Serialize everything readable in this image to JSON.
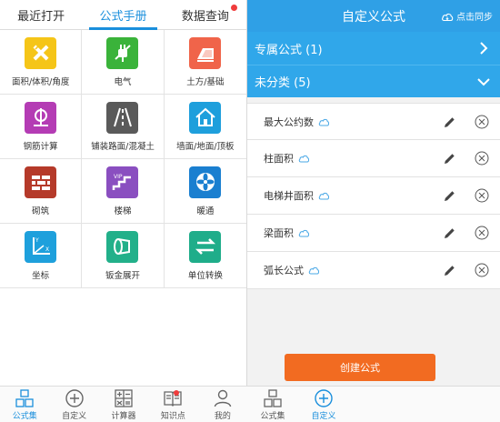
{
  "left": {
    "tabs": [
      {
        "label": "最近打开"
      },
      {
        "label": "公式手册"
      },
      {
        "label": "数据查询"
      }
    ],
    "grid": [
      {
        "label": "面积/体积/角度",
        "icon": "ruler-pencil-icon",
        "color": "#f5c518"
      },
      {
        "label": "电气",
        "icon": "plug-icon",
        "color": "#3ab33a"
      },
      {
        "label": "土方/基础",
        "icon": "earthwork-icon",
        "color": "#f0644a"
      },
      {
        "label": "钢筋计算",
        "icon": "rebar-icon",
        "color": "#b43cb4"
      },
      {
        "label": "铺装路面/混凝土",
        "icon": "road-icon",
        "color": "#5a5a5a"
      },
      {
        "label": "墙面/地面/顶板",
        "icon": "house-icon",
        "color": "#1e9fdc"
      },
      {
        "label": "砌筑",
        "icon": "brick-wall-icon",
        "color": "#b53a2a"
      },
      {
        "label": "楼梯",
        "icon": "stairs-icon",
        "color": "#8a4fc0"
      },
      {
        "label": "暖通",
        "icon": "fan-icon",
        "color": "#1a7fd0"
      },
      {
        "label": "坐标",
        "icon": "axis-icon",
        "color": "#1ea0dc"
      },
      {
        "label": "钣金展开",
        "icon": "sheet-metal-icon",
        "color": "#22b08a"
      },
      {
        "label": "单位转换",
        "icon": "convert-arrows-icon",
        "color": "#1fad8a"
      }
    ],
    "nav": [
      {
        "label": "公式集"
      },
      {
        "label": "自定义"
      },
      {
        "label": "计算器"
      },
      {
        "label": "知识点"
      },
      {
        "label": "我的"
      }
    ]
  },
  "right": {
    "title": "自定义公式",
    "sync_label": "点击同步",
    "groups": [
      {
        "label": "专属公式 (1)"
      },
      {
        "label": "未分类 (5)"
      }
    ],
    "formulas": [
      {
        "name": "最大公约数"
      },
      {
        "name": "柱面积"
      },
      {
        "name": "电梯井面积"
      },
      {
        "name": "梁面积"
      },
      {
        "name": "弧长公式"
      }
    ],
    "create_label": "创建公式",
    "nav": [
      {
        "label": "公式集"
      },
      {
        "label": "自定义"
      }
    ]
  },
  "colors": {
    "accent": "#1a8fdc",
    "header_blue": "#2fa0e6",
    "group_blue": "#30a7ea",
    "create_orange": "#f26b21",
    "badge_red": "#f03c3c"
  }
}
